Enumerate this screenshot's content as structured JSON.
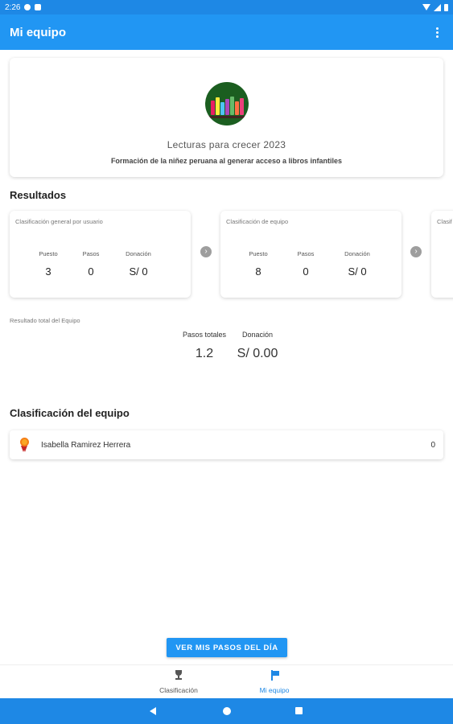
{
  "status_bar": {
    "time": "2:26"
  },
  "app_bar": {
    "title": "Mi equipo",
    "menu_icon": "more-vert-icon"
  },
  "campaign": {
    "title": "Lecturas para crecer 2023",
    "subtitle": "Formación de la niñez peruana al generar acceso a libros infantiles",
    "logo_icon": "bookshelf-logo"
  },
  "results": {
    "section_title": "Resultados",
    "cards": [
      {
        "label": "Clasificación general por usuario",
        "stats": [
          {
            "label": "Puesto",
            "value": "3"
          },
          {
            "label": "Pasos",
            "value": "0"
          },
          {
            "label": "Donación",
            "value": "S/ 0"
          }
        ]
      },
      {
        "label": "Clasificación de equipo",
        "stats": [
          {
            "label": "Puesto",
            "value": "8"
          },
          {
            "label": "Pasos",
            "value": "0"
          },
          {
            "label": "Donación",
            "value": "S/ 0"
          }
        ]
      },
      {
        "label": "Clasif"
      }
    ],
    "arrow_icon": "chevron-right-icon"
  },
  "team_total": {
    "label": "Resultado total del Equipo",
    "steps_label": "Pasos totales",
    "steps_value": "1.2",
    "donation_label": "Donación",
    "donation_value": "S/ 0.00"
  },
  "team_ranking": {
    "section_title": "Clasificación del equipo",
    "members": [
      {
        "name": "Isabella Ramirez Herrera",
        "steps": "0",
        "icon": "medal-icon"
      }
    ]
  },
  "cta": {
    "label": "VER MIS PASOS DEL DÍA"
  },
  "bottom_nav": {
    "items": [
      {
        "label": "Clasificación",
        "icon": "trophy-icon",
        "active": false
      },
      {
        "label": "Mi equipo",
        "icon": "flag-icon",
        "active": true
      }
    ],
    "active_color": "#1e88e5",
    "inactive_color": "#555555"
  },
  "colors": {
    "primary": "#2196f3",
    "status_bar": "#1e88e5"
  }
}
